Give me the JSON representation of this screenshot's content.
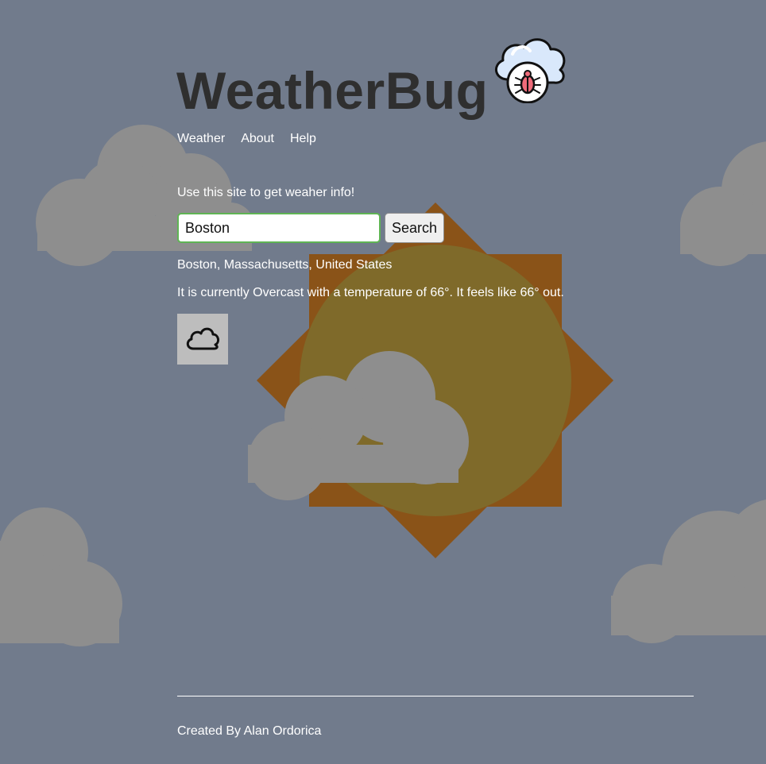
{
  "header": {
    "title": "WeatherBug",
    "logo_icon": "cloud-bug-icon"
  },
  "nav": {
    "items": [
      {
        "label": "Weather"
      },
      {
        "label": "About"
      },
      {
        "label": "Help"
      }
    ]
  },
  "main": {
    "intro": "Use this site to get weaher info!",
    "search": {
      "value": "Boston",
      "button_label": "Search"
    },
    "location": "Boston, Massachusetts, United States",
    "conditions": "It is currently Overcast with a temperature of 66°. It feels like 66° out.",
    "weather_icon": "overcast-cloud-icon"
  },
  "footer": {
    "credit": "Created By Alan Ordorica"
  },
  "colors": {
    "background": "#717b8c",
    "title": "#2f2f2f",
    "text": "#ffffff",
    "sun_orange": "#8a5318",
    "sun_core": "#7f6a2a",
    "cloud_gray": "#8e8e8e",
    "input_border": "#5fb454",
    "icon_box": "#bdbdbd"
  }
}
